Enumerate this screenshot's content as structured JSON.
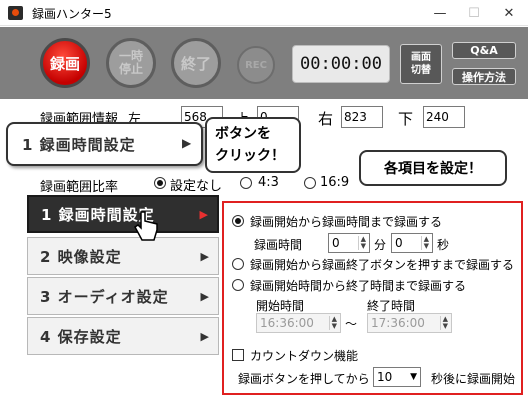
{
  "window": {
    "title": "録画ハンター5",
    "minimize": "—",
    "maximize": "☐",
    "close": "✕"
  },
  "toolbar": {
    "record": "録画",
    "pause": "一時停止",
    "end": "終了",
    "rec_small": "REC",
    "timer": "00:00:00",
    "screen_switch": "画面切替",
    "qa": "Q&A",
    "howto": "操作方法"
  },
  "range_info": {
    "label": "録画範囲情報",
    "left_label": "左",
    "left_value": "568",
    "top_label": "上",
    "top_value": "0",
    "right_label": "右",
    "right_value": "823",
    "bottom_label": "下",
    "bottom_value": "240",
    "ratio_label": "録画範囲比率",
    "opt_free": "設定なし",
    "opt_43": "4:3",
    "opt_169": "16:9"
  },
  "callouts": {
    "click_tab": "1 録画時間設定",
    "click_msg_line1": "ボタンを",
    "click_msg_line2": "クリック！",
    "settings_msg": "各項目を設定！"
  },
  "menu": [
    {
      "label": "1 録画時間設定",
      "active": true
    },
    {
      "label": "2 映像設定",
      "active": false
    },
    {
      "label": "3 オーディオ設定",
      "active": false
    },
    {
      "label": "4 保存設定",
      "active": false
    }
  ],
  "panel": {
    "opt1": "録画開始から録画時間まで録画する",
    "duration_label": "録画時間",
    "minutes_value": "0",
    "minutes_unit": "分",
    "seconds_value": "0",
    "seconds_unit": "秒",
    "opt2": "録画開始から録画終了ボタンを押すまで録画する",
    "opt3": "録画開始時間から終了時間まで録画する",
    "start_label": "開始時間",
    "end_label": "終了時間",
    "start_value": "16:36:00",
    "tilde": "〜",
    "end_value": "17:36:00",
    "countdown_label": "カウントダウン機能",
    "countdown_prefix": "録画ボタンを押してから",
    "countdown_value": "10",
    "countdown_suffix": "秒後に録画開始"
  },
  "colors": {
    "accent_red": "#e02020",
    "toolbar_gray": "#7f7f7f",
    "menu_active": "#2f2f2f"
  }
}
